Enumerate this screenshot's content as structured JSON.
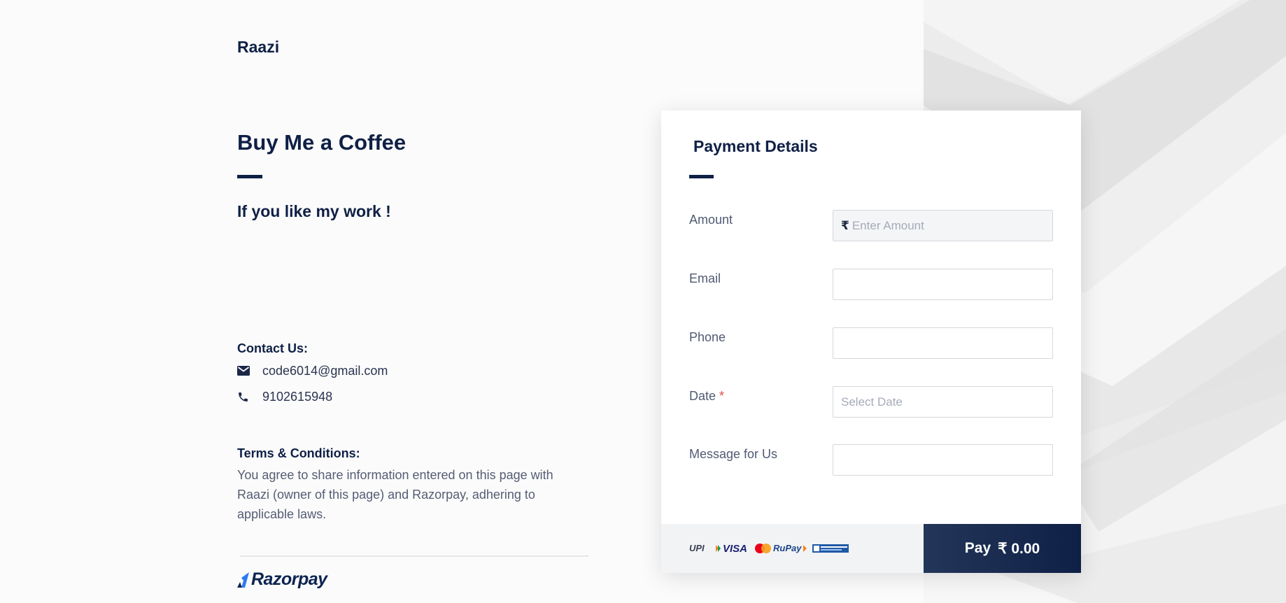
{
  "page": {
    "brand_name": "Raazi",
    "title": "Buy Me a Coffee",
    "subtitle": "If you like my work !"
  },
  "contact": {
    "heading": "Contact Us:",
    "email_icon": "mail-icon",
    "email": "code6014@gmail.com",
    "phone_icon": "phone-icon",
    "phone": "9102615948"
  },
  "terms": {
    "heading": "Terms & Conditions:",
    "text": "You agree to share information entered on this page with Raazi (owner of this page) and Razorpay, adhering to applicable laws."
  },
  "footer_logo": {
    "text": "Razorpay"
  },
  "payment": {
    "title": "Payment Details",
    "fields": {
      "amount": {
        "label": "Amount",
        "currency_symbol": "₹",
        "placeholder": "Enter Amount",
        "value": ""
      },
      "email": {
        "label": "Email",
        "value": ""
      },
      "phone": {
        "label": "Phone",
        "value": ""
      },
      "date": {
        "label": "Date",
        "required_mark": "*",
        "placeholder": "Select Date",
        "value": ""
      },
      "message": {
        "label": "Message for Us",
        "value": ""
      }
    },
    "methods_icons": [
      "upi-icon",
      "visa-icon",
      "mastercard-icon",
      "rupay-icon",
      "netbanking-icon"
    ],
    "methods_text": {
      "upi": "UPI",
      "visa": "VISA",
      "rupay": "RuPay"
    },
    "pay_button": {
      "label": "Pay",
      "amount": "₹ 0.00"
    }
  },
  "colors": {
    "navy": "#0f2046",
    "pay_button_start": "#233659",
    "pay_button_end": "#0f2046",
    "required": "#e04b4b",
    "background": "#fbfbfb"
  }
}
